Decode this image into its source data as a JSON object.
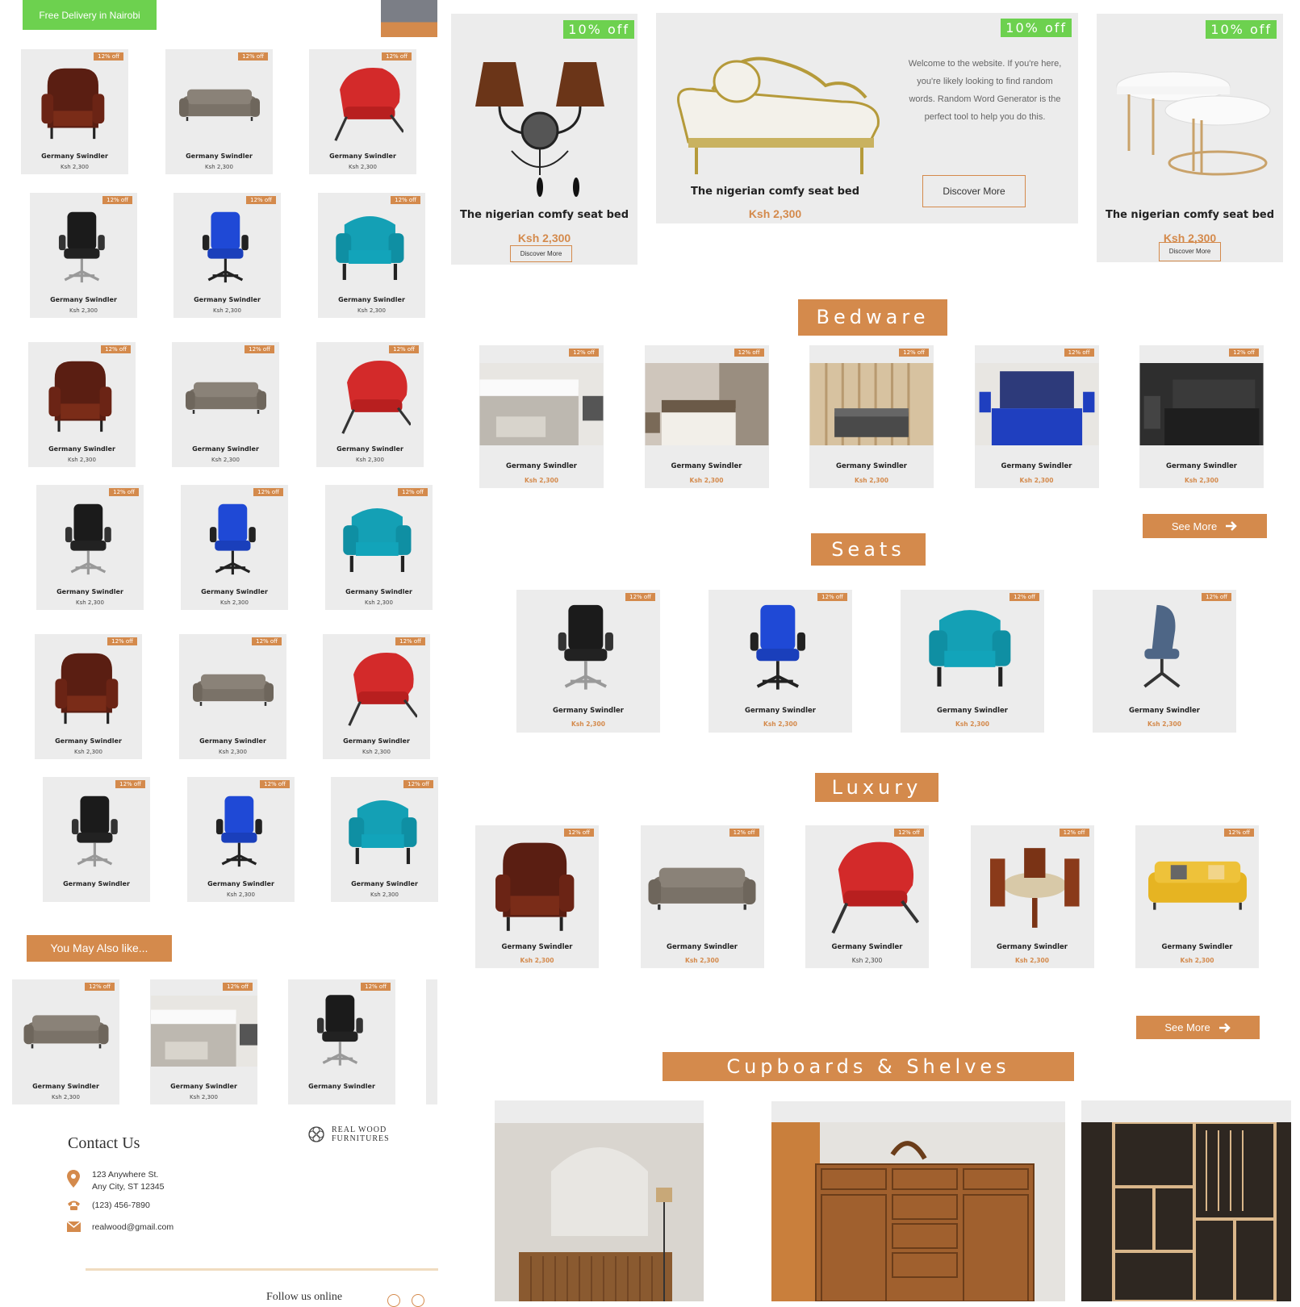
{
  "header": {
    "delivery": "Free Delivery in Nairobi"
  },
  "product": {
    "name": "Germany Swindler",
    "price": "Ksh 2,300",
    "badge": "12% off"
  },
  "hero": {
    "off": "10% off",
    "title": "The nigerian comfy seat bed",
    "price": "Ksh 2,300",
    "discover": "Discover More",
    "welcome": "Welcome to the website. If you're here, you're likely looking to find random words. Random Word Generator is the perfect tool to help you do this."
  },
  "sections": {
    "bedware": "Bedware",
    "seats": "Seats",
    "luxury": "Luxury",
    "cupboards": "Cupboards & Shelves",
    "see_more": "See More"
  },
  "sidebar": {
    "also_like": "You May Also like..."
  },
  "contact": {
    "title": "Contact Us",
    "address1": "123 Anywhere St.",
    "address2": "Any City, ST 12345",
    "phone": "(123) 456-7890",
    "email": "realwood@gmail.com",
    "follow": "Follow us online"
  },
  "brand": {
    "line1": "REAL WOOD",
    "line2": "FURNITURES"
  },
  "colors": {
    "accent": "#d48a4c",
    "green": "#6dd14f",
    "card": "#ececec"
  },
  "icons": [
    "map-pin-icon",
    "phone-icon",
    "mail-icon",
    "arrow-right-icon",
    "brand-logo-icon"
  ]
}
